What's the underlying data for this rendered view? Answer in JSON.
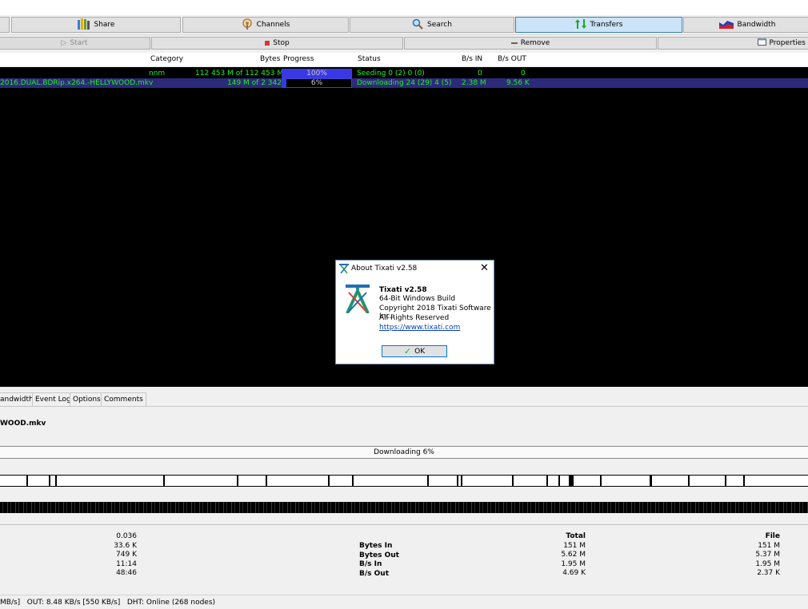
{
  "nav": {
    "share": "Share",
    "channels": "Channels",
    "search": "Search",
    "transfers": "Transfers",
    "bandwidth": "Bandwidth"
  },
  "actions": {
    "start": "Start",
    "stop": "Stop",
    "remove": "Remove",
    "properties": "Properties"
  },
  "table": {
    "headers": {
      "category": "Category",
      "bytes": "Bytes",
      "progress": "Progress",
      "status": "Status",
      "bs_in": "B/s IN",
      "bs_out": "B/s OUT"
    },
    "rows": [
      {
        "name": "",
        "category": "nnm",
        "bytes": "112 453 M of 112 453 M",
        "progress_label": "100%",
        "progress": 1.0,
        "status": "Seeding 0 (2) 0 (0)",
        "bs_in": "0",
        "bs_out": "0"
      },
      {
        "name": "2016.DUAL.BDRip.x264.-HELLYWOOD.mkv",
        "category": "",
        "bytes": "149 M of 2 342 M",
        "progress_label": "6%",
        "progress": 0.06,
        "status": "Downloading 24 (29) 4 (5)",
        "bs_in": "2.38 M",
        "bs_out": "9.56 K"
      }
    ]
  },
  "about": {
    "title": "About Tixati v2.58",
    "product": "Tixati v2.58",
    "build": "64-Bit Windows Build",
    "copyright": "Copyright 2018 Tixati Software Inc.",
    "rights": "All Rights Reserved",
    "url": "https://www.tixati.com",
    "ok": "OK"
  },
  "detail_tabs": [
    "andwidth",
    "Event Log",
    "Options",
    "Comments"
  ],
  "detail": {
    "filename": "WOOD.mkv",
    "progress_text": "Downloading 6%",
    "left_values": [
      "0.036",
      "33.6 K",
      "749 K",
      "11:14",
      "48:46"
    ],
    "stat_labels": [
      "Bytes In",
      "Bytes Out",
      "B/s In",
      "B/s Out"
    ],
    "total_header": "Total",
    "total_values": [
      "151 M",
      "5.62 M",
      "1.95 M",
      "4.69 K"
    ],
    "file_header": "File",
    "file_values": [
      "151 M",
      "5.37 M",
      "1.95 M",
      "2.37 K"
    ]
  },
  "statusbar": "MB/s]   OUT: 8.48 KB/s [550 KB/s]   DHT: Online (268 nodes)"
}
